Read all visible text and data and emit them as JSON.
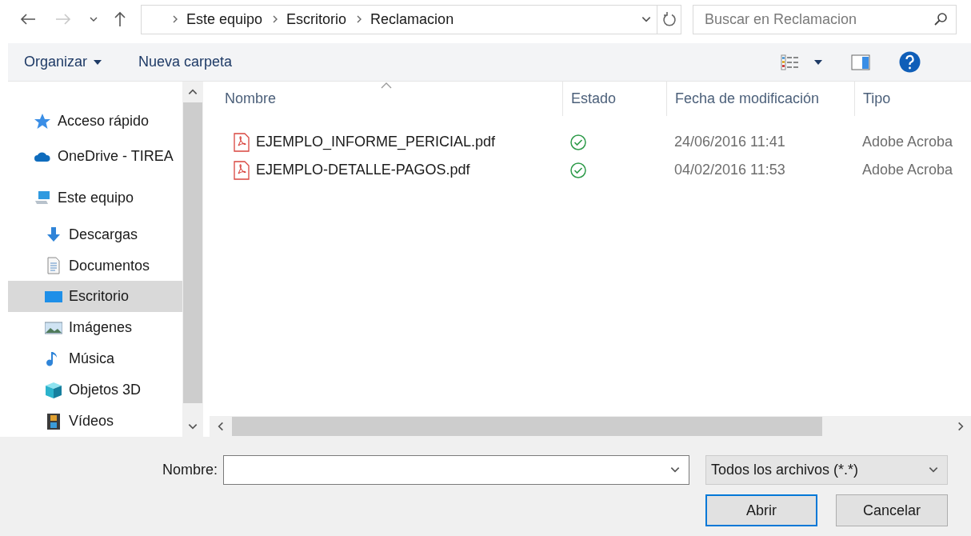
{
  "nav_buttons": [
    {
      "kind": "back",
      "disabled": false
    },
    {
      "kind": "forward",
      "disabled": true
    },
    {
      "kind": "recent",
      "disabled": false
    },
    {
      "kind": "up",
      "disabled": false
    }
  ],
  "breadcrumb": [
    "Este equipo",
    "Escritorio",
    "Reclamacion"
  ],
  "search": {
    "placeholder": "Buscar en Reclamacion"
  },
  "toolbar": {
    "organize": "Organizar",
    "new_folder": "Nueva carpeta"
  },
  "sidebar": {
    "items": [
      {
        "label": "Acceso rápido",
        "kind": "star",
        "selected": false
      },
      {
        "label": "OneDrive - TIREA",
        "kind": "cloud",
        "selected": false
      },
      {
        "label": "Este equipo",
        "kind": "computer",
        "selected": false,
        "children": [
          {
            "label": "Descargas",
            "kind": "download",
            "selected": false
          },
          {
            "label": "Documentos",
            "kind": "document",
            "selected": false
          },
          {
            "label": "Escritorio",
            "kind": "desktop",
            "selected": true
          },
          {
            "label": "Imágenes",
            "kind": "image",
            "selected": false
          },
          {
            "label": "Música",
            "kind": "music",
            "selected": false
          },
          {
            "label": "Objetos 3D",
            "kind": "cube",
            "selected": false
          },
          {
            "label": "Vídeos",
            "kind": "video",
            "selected": false
          }
        ]
      }
    ]
  },
  "table": {
    "columns": [
      {
        "label": "Nombre",
        "sorted": true
      },
      {
        "label": "Estado",
        "sorted": false
      },
      {
        "label": "Fecha de modificación",
        "sorted": false
      },
      {
        "label": "Tipo",
        "sorted": false
      }
    ],
    "rows": [
      {
        "name": "EJEMPLO_INFORME_PERICIAL.pdf",
        "synced": true,
        "modified": "24/06/2016 11:41",
        "type": "Adobe Acroba"
      },
      {
        "name": "EJEMPLO-DETALLE-PAGOS.pdf",
        "synced": true,
        "modified": "04/02/2016 11:53",
        "type": "Adobe Acroba"
      }
    ]
  },
  "footer": {
    "filename_label": "Nombre:",
    "filter": "Todos los archivos (*.*)",
    "buttons": [
      {
        "label": "Abrir",
        "default": true
      },
      {
        "label": "Cancelar",
        "default": false
      }
    ]
  }
}
